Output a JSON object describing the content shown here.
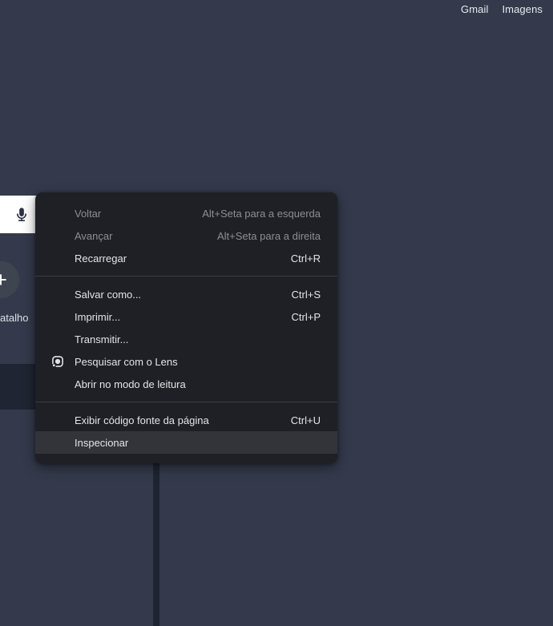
{
  "page": {
    "header_links": [
      {
        "label": "Gmail"
      },
      {
        "label": "Imagens"
      }
    ],
    "shortcut_tile": {
      "plus_glyph": "+",
      "label_fragment": "atalho"
    }
  },
  "menu": {
    "items": [
      {
        "label": "Voltar",
        "shortcut": "Alt+Seta para a esquerda",
        "state": "disabled"
      },
      {
        "label": "Avançar",
        "shortcut": "Alt+Seta para a direita",
        "state": "disabled"
      },
      {
        "label": "Recarregar",
        "shortcut": "Ctrl+R",
        "state": "normal"
      },
      {
        "label": "Salvar como...",
        "shortcut": "Ctrl+S",
        "state": "normal"
      },
      {
        "label": "Imprimir...",
        "shortcut": "Ctrl+P",
        "state": "normal"
      },
      {
        "label": "Transmitir...",
        "shortcut": "",
        "state": "normal"
      },
      {
        "label": "Pesquisar com o Lens",
        "shortcut": "",
        "state": "normal",
        "icon": "lens-icon"
      },
      {
        "label": "Abrir no modo de leitura",
        "shortcut": "",
        "state": "normal"
      },
      {
        "label": "Exibir código fonte da página",
        "shortcut": "Ctrl+U",
        "state": "normal"
      },
      {
        "label": "Inspecionar",
        "shortcut": "",
        "state": "hovered"
      }
    ]
  },
  "colors": {
    "page_background": "#343a4c",
    "menu_background": "#1e2025",
    "menu_hover": "#323439",
    "menu_separator": "#3b3d42",
    "menu_text": "#e3e4e6",
    "menu_text_disabled": "#8b8e94",
    "header_link_text": "#e8eaed",
    "searchbar_background": "#ffffff",
    "plus_circle_background": "#3f4550",
    "dark_band": "#1f2532",
    "vertical_stripe": "#1f2433"
  }
}
